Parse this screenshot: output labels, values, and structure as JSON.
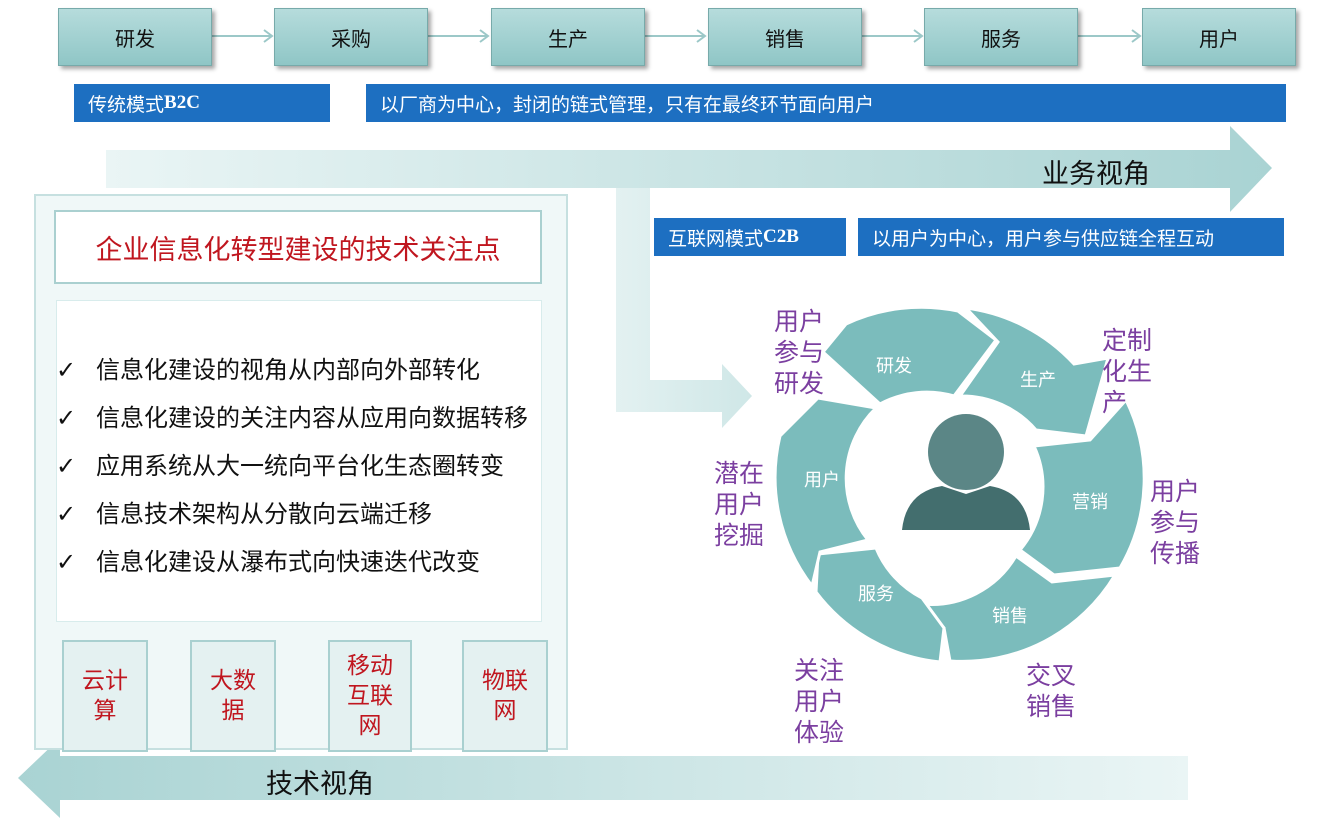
{
  "value_chain": [
    "研发",
    "采购",
    "生产",
    "销售",
    "服务",
    "用户"
  ],
  "b2c": {
    "label_prefix": "传统模式",
    "label_code": "B2C",
    "description": "以厂商为中心，封闭的链式管理，只有在最终环节面向用户"
  },
  "business_view": "业务视角",
  "c2b": {
    "label_prefix": "互联网模式",
    "label_code": "C2B",
    "description": "以用户为中心，用户参与供应链全程互动"
  },
  "left_panel": {
    "title": "企业信息化转型建设的技术关注点",
    "items": [
      "信息化建设的视角从内部向外部转化",
      "信息化建设的关注内容从应用向数据转移",
      "应用系统从大一统向平台化生态圈转变",
      "信息技术架构从分散向云端迁移",
      "信息化建设从瀑布式向快速迭代改变"
    ],
    "tech_boxes": [
      "云计算",
      "大数据",
      "移动互联网",
      "物联网"
    ]
  },
  "tech_view": "技术视角",
  "cycle": {
    "segments": [
      "研发",
      "生产",
      "营销",
      "销售",
      "服务",
      "用户"
    ],
    "outer_labels": [
      "用户参与研发",
      "定制化生产",
      "用户参与传播",
      "交叉销售",
      "关注用户体验",
      "潜在用户挖掘"
    ]
  },
  "colors": {
    "teal": "#7bbcbc",
    "blue": "#1d6fc1",
    "red": "#c0161f",
    "purple": "#7b3fa0"
  }
}
